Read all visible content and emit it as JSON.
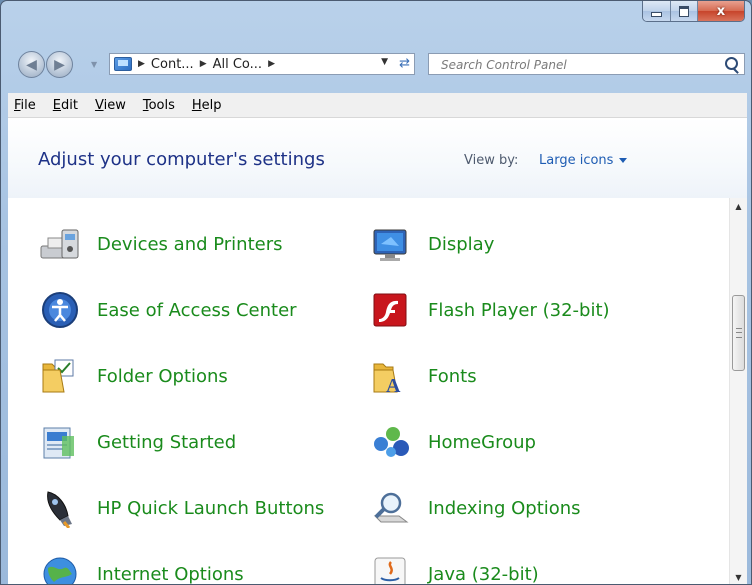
{
  "window": {
    "close_glyph": "x"
  },
  "nav": {
    "back_glyph": "◀",
    "forward_glyph": "▶",
    "breadcrumbs": [
      "Cont...",
      "All Co..."
    ],
    "separator": "▶",
    "dropdown_glyph": "▼",
    "refresh_glyph": "⇄",
    "search_placeholder": "Search Control Panel"
  },
  "menubar": {
    "file": {
      "mnemonic": "F",
      "rest": "ile"
    },
    "edit": {
      "pre": "",
      "mnemonic": "E",
      "rest": "dit"
    },
    "view": {
      "mnemonic": "V",
      "rest": "iew"
    },
    "tools": {
      "mnemonic": "T",
      "rest": "ools"
    },
    "help": {
      "mnemonic": "H",
      "rest": "elp"
    }
  },
  "header": {
    "title": "Adjust your computer's settings",
    "view_by_label": "View by:",
    "view_mode": "Large icons"
  },
  "items": [
    {
      "label": "Devices and Printers",
      "icon": "printer-icon"
    },
    {
      "label": "Display",
      "icon": "display-icon"
    },
    {
      "label": "Ease of Access Center",
      "icon": "ease-of-access-icon"
    },
    {
      "label": "Flash Player (32-bit)",
      "icon": "flash-player-icon"
    },
    {
      "label": "Folder Options",
      "icon": "folder-options-icon"
    },
    {
      "label": "Fonts",
      "icon": "fonts-folder-icon"
    },
    {
      "label": "Getting Started",
      "icon": "getting-started-icon"
    },
    {
      "label": "HomeGroup",
      "icon": "homegroup-icon"
    },
    {
      "label": "HP Quick Launch Buttons",
      "icon": "rocket-icon"
    },
    {
      "label": "Indexing Options",
      "icon": "magnifier-icon"
    },
    {
      "label": "Internet Options",
      "icon": "globe-icon"
    },
    {
      "label": "Java (32-bit)",
      "icon": "java-icon"
    }
  ],
  "scrollbar": {
    "up_glyph": "▲",
    "down_glyph": "▼"
  }
}
